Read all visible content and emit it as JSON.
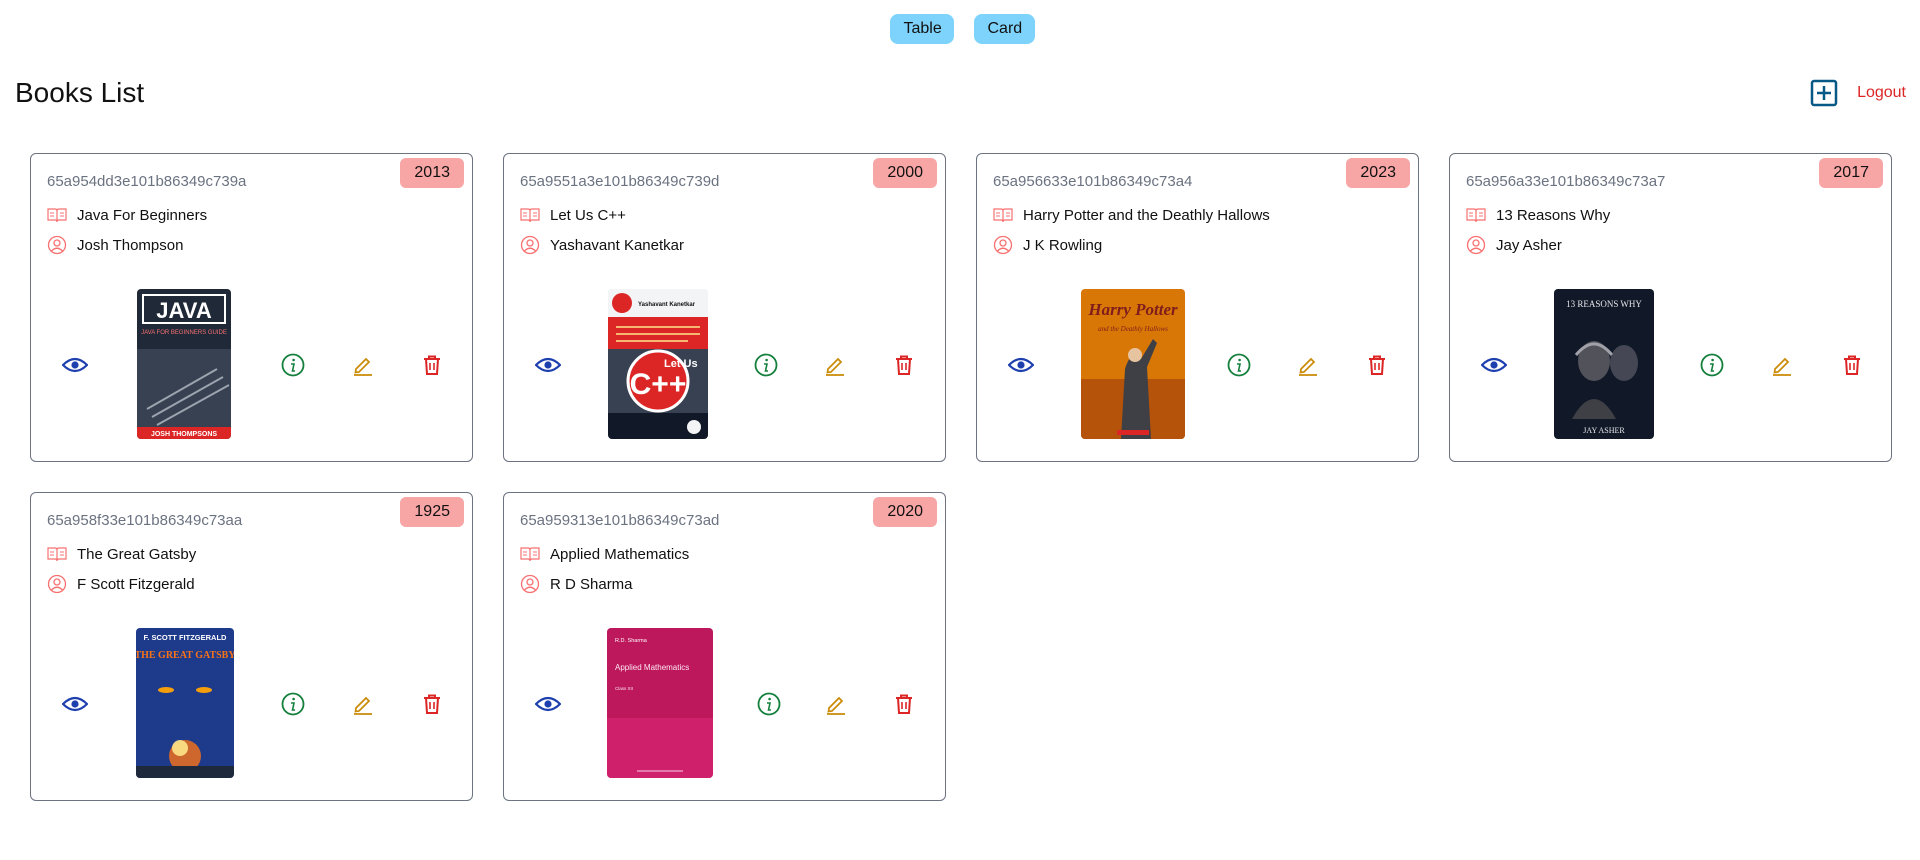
{
  "view_toggle": {
    "table_label": "Table",
    "card_label": "Card"
  },
  "page": {
    "title": "Books List",
    "logout_label": "Logout"
  },
  "colors": {
    "accent": "#7dd3fc",
    "badge": "#f8a5a5",
    "view": "#1e40af",
    "info": "#15803d",
    "edit": "#ca8a04",
    "delete": "#dc2626",
    "meta_icon": "#f87171",
    "add": "#075985"
  },
  "icons": {
    "add": "plus-square-icon",
    "title": "book-open-icon",
    "author": "user-circle-icon",
    "view": "eye-icon",
    "info": "info-circle-icon",
    "edit": "pencil-icon",
    "delete": "trash-icon"
  },
  "books": [
    {
      "id": "65a954dd3e101b86349c739a",
      "title": "Java For Beginners",
      "author": "Josh Thompson",
      "year": "2013",
      "cover": {
        "top_text": "JAVA",
        "sub_text": "JAVA FOR BEGINNERS GUIDE",
        "bottom_text": "JOSH THOMPSONS"
      }
    },
    {
      "id": "65a9551a3e101b86349c739d",
      "title": "Let Us C++",
      "author": "Yashavant Kanetkar",
      "year": "2000",
      "cover": {
        "top_text": "Yashavant Kanetkar",
        "sub_text": "Let Us",
        "bottom_text": "C++"
      }
    },
    {
      "id": "65a956633e101b86349c73a4",
      "title": "Harry Potter and the Deathly Hallows",
      "author": "J K Rowling",
      "year": "2023",
      "cover": {
        "top_text": "Harry Potter",
        "sub_text": "and the Deathly Hallows",
        "bottom_text": ""
      }
    },
    {
      "id": "65a956a33e101b86349c73a7",
      "title": "13 Reasons Why",
      "author": "Jay Asher",
      "year": "2017",
      "cover": {
        "top_text": "13 REASONS WHY",
        "sub_text": "",
        "bottom_text": "JAY ASHER"
      }
    },
    {
      "id": "65a958f33e101b86349c73aa",
      "title": "The Great Gatsby",
      "author": "F Scott Fitzgerald",
      "year": "1925",
      "cover": {
        "top_text": "F. SCOTT FITZGERALD",
        "sub_text": "THE GREAT GATSBY",
        "bottom_text": ""
      }
    },
    {
      "id": "65a959313e101b86349c73ad",
      "title": "Applied Mathematics",
      "author": "R D Sharma",
      "year": "2020",
      "cover": {
        "top_text": "R.D. Sharma",
        "sub_text": "Applied Mathematics",
        "bottom_text": "Class XII"
      }
    }
  ]
}
